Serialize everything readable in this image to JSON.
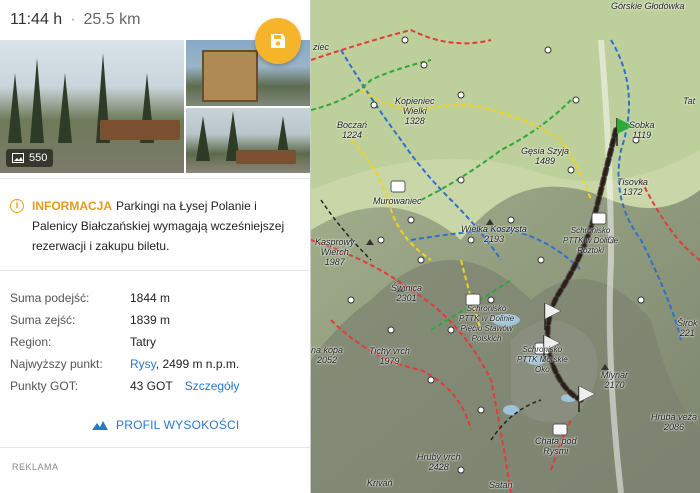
{
  "header": {
    "duration": "11:44 h",
    "distance": "25.5 km"
  },
  "photos": {
    "count": "550"
  },
  "info": {
    "label": "INFORMACJA",
    "text": "Parkingi na Łysej Polanie i Palenicy Białczańskiej wymagają wcześniejszej rezerwacji i zakupu biletu."
  },
  "stats": {
    "ascent_label": "Suma podejść:",
    "ascent_value": "1844 m",
    "descent_label": "Suma zejść:",
    "descent_value": "1839 m",
    "region_label": "Region:",
    "region_value": "Tatry",
    "highest_label": "Najwyższy punkt:",
    "highest_link": "Rysy",
    "highest_rest": ", 2499 m n.p.m.",
    "got_label": "Punkty GOT:",
    "got_value": "43 GOT",
    "got_link": "Szczegóły"
  },
  "profile_button": "PROFIL WYSOKOŚCI",
  "ads_label": "REKLAMA",
  "map": {
    "labels": {
      "gorskie": "Górskie Głodówka",
      "ziec": "ziec",
      "kopieniec": "Kopieniec\nWielki\n1328",
      "boczan": "Boczań\n1224",
      "gesia": "Gęsia Szyja\n1489",
      "sobka": "Sobka\n1119",
      "tisovka": "Tisovka\n1372",
      "murowaniec": "Murowaniec",
      "koszysta": "Wielka Koszysta\n2193",
      "schronisko5": "Schronisko\nPTTK w Dolinie\nRoztoki",
      "kasprowy": "Kasprowy\nWierch\n1987",
      "swinica": "Świnica\n2301",
      "schronisko_piec": "Schronisko\nPTTK w Dolinie\nPięciu Stawów\nPolskich",
      "schronisko_mok": "Schronisko\nPTTK Morskie\nOko",
      "kopa": "na kopa\n2052",
      "tichy": "Tichý vrch\n1979",
      "mlynar": "Mlynár\n2170",
      "chata": "Chata pod\nRysmi",
      "hrubyvrch": "Hrubý vrch\n2428",
      "hrebenok": "Hrubá veža\n2086",
      "sirok": "Širok\n221",
      "tat": "Tat",
      "krivan": "Kriváň",
      "satan": "Satan"
    }
  }
}
